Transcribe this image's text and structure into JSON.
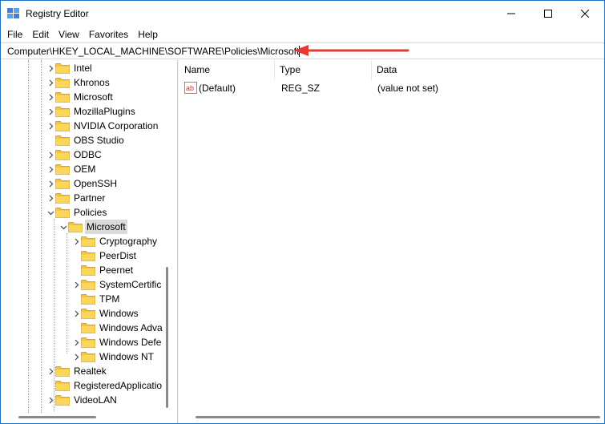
{
  "window": {
    "title": "Registry Editor"
  },
  "menu": [
    "File",
    "Edit",
    "View",
    "Favorites",
    "Help"
  ],
  "address": {
    "path": "Computer\\HKEY_LOCAL_MACHINE\\SOFTWARE\\Policies\\Microsoft"
  },
  "tree": {
    "items": [
      {
        "label": "Intel"
      },
      {
        "label": "Khronos"
      },
      {
        "label": "Microsoft"
      },
      {
        "label": "MozillaPlugins"
      },
      {
        "label": "NVIDIA Corporation"
      },
      {
        "label": "OBS Studio"
      },
      {
        "label": "ODBC"
      },
      {
        "label": "OEM"
      },
      {
        "label": "OpenSSH"
      },
      {
        "label": "Partner"
      },
      {
        "label": "Policies"
      },
      {
        "label": "Microsoft"
      },
      {
        "label": "Cryptography"
      },
      {
        "label": "PeerDist"
      },
      {
        "label": "Peernet"
      },
      {
        "label": "SystemCertific"
      },
      {
        "label": "TPM"
      },
      {
        "label": "Windows"
      },
      {
        "label": "Windows Adva"
      },
      {
        "label": "Windows Defe"
      },
      {
        "label": "Windows NT"
      },
      {
        "label": "Realtek"
      },
      {
        "label": "RegisteredApplicatio"
      },
      {
        "label": "VideoLAN"
      }
    ]
  },
  "list": {
    "columns": [
      "Name",
      "Type",
      "Data"
    ],
    "rows": [
      {
        "icon": "string-value-icon",
        "name": "(Default)",
        "type": "REG_SZ",
        "data": "(value not set)"
      }
    ]
  },
  "colors": {
    "folder": "#f4c542",
    "folder_dark": "#e0a800",
    "annotation_arrow": "#e53935",
    "window_border": "#1a73c8"
  }
}
